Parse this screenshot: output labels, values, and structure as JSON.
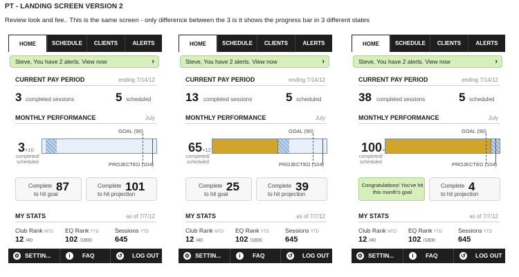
{
  "page": {
    "title": "PT - LANDING SCREEN VERSION 2",
    "description": "Review look and fee.. This is the same screen - only difference between the 3 is it shows the progress bar in 3 different states"
  },
  "colors": {
    "accent_bar": "#d1a52c",
    "alert_bg": "#d7efbd",
    "nav_bg": "#1e1e1e"
  },
  "screens": [
    {
      "tabs": [
        "HOME",
        "SCHEDULE",
        "CLIENTS",
        "ALERTS"
      ],
      "alert": "Steve, You have 2 alerts. View now",
      "pay_period": {
        "title": "CURRENT PAY PERIOD",
        "ending": "ending 7/14/12",
        "completed_num": "3",
        "completed_label": "completed sessions",
        "scheduled_num": "5",
        "scheduled_label": "scheduled"
      },
      "performance": {
        "title": "MONTHLY PERFORMANCE",
        "month": "July",
        "value": "3",
        "plus": "+10",
        "sub": "completed/ scheduled",
        "goal_label": "GOAL (90)",
        "projected_label": "PROJECTED (104)",
        "fill_fraction": 0.03,
        "stripe_fraction": 0.1
      },
      "complete_goal": {
        "label_top": "Complete",
        "num": "87",
        "label_bottom": "to hit goal",
        "congrats": ""
      },
      "complete_proj": {
        "label_top": "Complete",
        "num": "101",
        "label_bottom": "to hit projection"
      },
      "stats": {
        "title": "MY STATS",
        "asof": "as of 7/7/12",
        "club_label": "Club Rank",
        "club_sfx": "MTD",
        "club_val": "12",
        "club_of": "/40",
        "eq_label": "EQ Rank",
        "eq_sfx": "YTD",
        "eq_val": "102",
        "eq_of": "/1800",
        "sess_label": "Sessions",
        "sess_sfx": "YTD",
        "sess_val": "645"
      },
      "footer": {
        "settings": "SETTIN...",
        "faq": "FAQ",
        "logout": "LOG OUT"
      }
    },
    {
      "tabs": [
        "HOME",
        "SCHEDULE",
        "CLIENTS",
        "ALERTS"
      ],
      "alert": "Steve, You have 2 alerts. View now",
      "pay_period": {
        "title": "CURRENT PAY PERIOD",
        "ending": "ending 7/14/12",
        "completed_num": "13",
        "completed_label": "completed sessions",
        "scheduled_num": "5",
        "scheduled_label": "scheduled"
      },
      "performance": {
        "title": "MONTHLY PERFORMANCE",
        "month": "July",
        "value": "65",
        "plus": "+12",
        "sub": "completed/ scheduled",
        "goal_label": "GOAL (90)",
        "projected_label": "PROJECTED (104)",
        "fill_fraction": 0.575,
        "stripe_fraction": 0.1
      },
      "complete_goal": {
        "label_top": "Complete",
        "num": "25",
        "label_bottom": "to hit goal",
        "congrats": ""
      },
      "complete_proj": {
        "label_top": "Complete",
        "num": "39",
        "label_bottom": "to hit projection"
      },
      "stats": {
        "title": "MY STATS",
        "asof": "as of 7/7/12",
        "club_label": "Club Rank",
        "club_sfx": "MTD",
        "club_val": "12",
        "club_of": "/40",
        "eq_label": "EQ Rank",
        "eq_sfx": "YTD",
        "eq_val": "102",
        "eq_of": "/1800",
        "sess_label": "Sessions",
        "sess_sfx": "YTD",
        "sess_val": "645"
      },
      "footer": {
        "settings": "SETTIN...",
        "faq": "FAQ",
        "logout": "LOG OUT"
      }
    },
    {
      "tabs": [
        "HOME",
        "SCHEDULE",
        "CLIENTS",
        "ALERTS"
      ],
      "alert": "Steve, You have 2 alerts. View now",
      "pay_period": {
        "title": "CURRENT PAY PERIOD",
        "ending": "ending 7/14/12",
        "completed_num": "38",
        "completed_label": "completed sessions",
        "scheduled_num": "5",
        "scheduled_label": "scheduled"
      },
      "performance": {
        "title": "MONTHLY PERFORMANCE",
        "month": "July",
        "value": "100",
        "plus": "+8",
        "sub": "completed/ scheduled",
        "goal_label": "GOAL (90)",
        "projected_label": "PROJECTED (104)",
        "fill_fraction": 0.925,
        "stripe_fraction": 0.075
      },
      "complete_goal": {
        "label_top": "",
        "num": "",
        "label_bottom": "",
        "congrats": "Congratulations! You've hit this month's goal"
      },
      "complete_proj": {
        "label_top": "Complete",
        "num": "4",
        "label_bottom": "to hit projection"
      },
      "stats": {
        "title": "MY STATS",
        "asof": "as of 7/7/12",
        "club_label": "Club Rank",
        "club_sfx": "MTD",
        "club_val": "12",
        "club_of": "/40",
        "eq_label": "EQ Rank",
        "eq_sfx": "YTD",
        "eq_val": "102",
        "eq_of": "/1800",
        "sess_label": "Sessions",
        "sess_sfx": "YTD",
        "sess_val": "645"
      },
      "footer": {
        "settings": "SETTIN...",
        "faq": "FAQ",
        "logout": "LOG OUT"
      }
    }
  ]
}
